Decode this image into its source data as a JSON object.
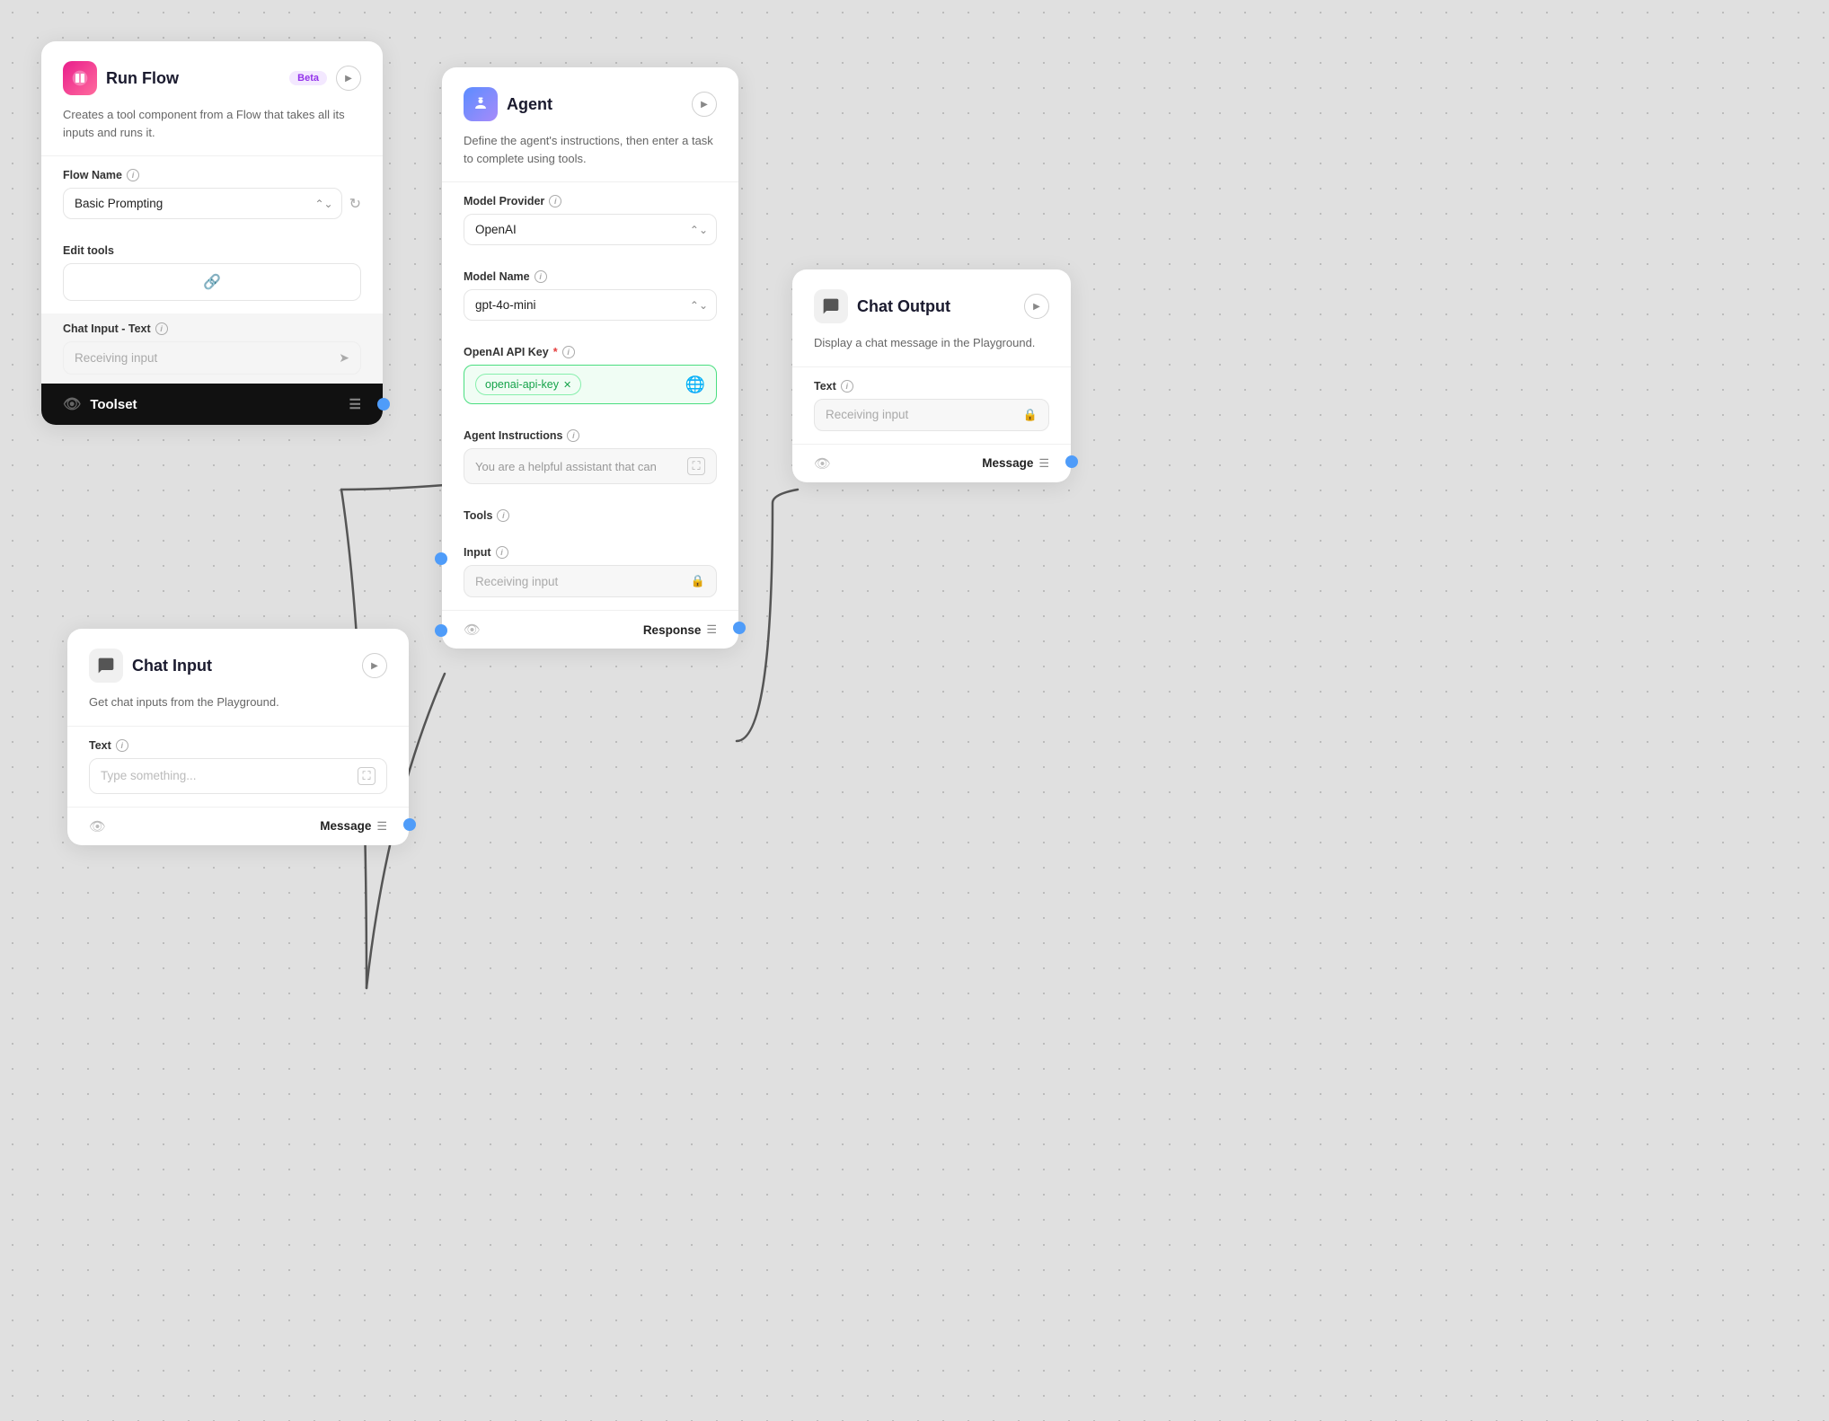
{
  "canvas": {
    "background": "#e0e0e0"
  },
  "runflow_card": {
    "title": "Run Flow",
    "beta_badge": "Beta",
    "description": "Creates a tool component from a Flow that takes all its inputs and runs it.",
    "flow_name_label": "Flow Name",
    "flow_name_value": "Basic Prompting",
    "edit_tools_label": "Edit tools",
    "edit_tools_icon": "🔗",
    "chat_input_text_label": "Chat Input - Text",
    "receiving_input_text": "Receiving input",
    "toolset_label": "Toolset"
  },
  "agent_card": {
    "title": "Agent",
    "description": "Define the agent's instructions, then enter a task to complete using tools.",
    "model_provider_label": "Model Provider",
    "model_provider_value": "OpenAI",
    "model_name_label": "Model Name",
    "model_name_value": "gpt-4o-mini",
    "api_key_label": "OpenAI API Key",
    "api_key_required": "*",
    "api_key_value": "openai-api-key",
    "agent_instructions_label": "Agent Instructions",
    "agent_instructions_placeholder": "You are a helpful assistant that can",
    "tools_label": "Tools",
    "input_label": "Input",
    "input_placeholder": "Receiving input",
    "response_label": "Response"
  },
  "chat_output_card": {
    "title": "Chat Output",
    "description": "Display a chat message in the Playground.",
    "text_label": "Text",
    "text_placeholder": "Receiving input",
    "message_label": "Message"
  },
  "chat_input_card": {
    "title": "Chat Input",
    "description": "Get chat inputs from the Playground.",
    "text_label": "Text",
    "text_placeholder": "Type something...",
    "message_label": "Message"
  }
}
